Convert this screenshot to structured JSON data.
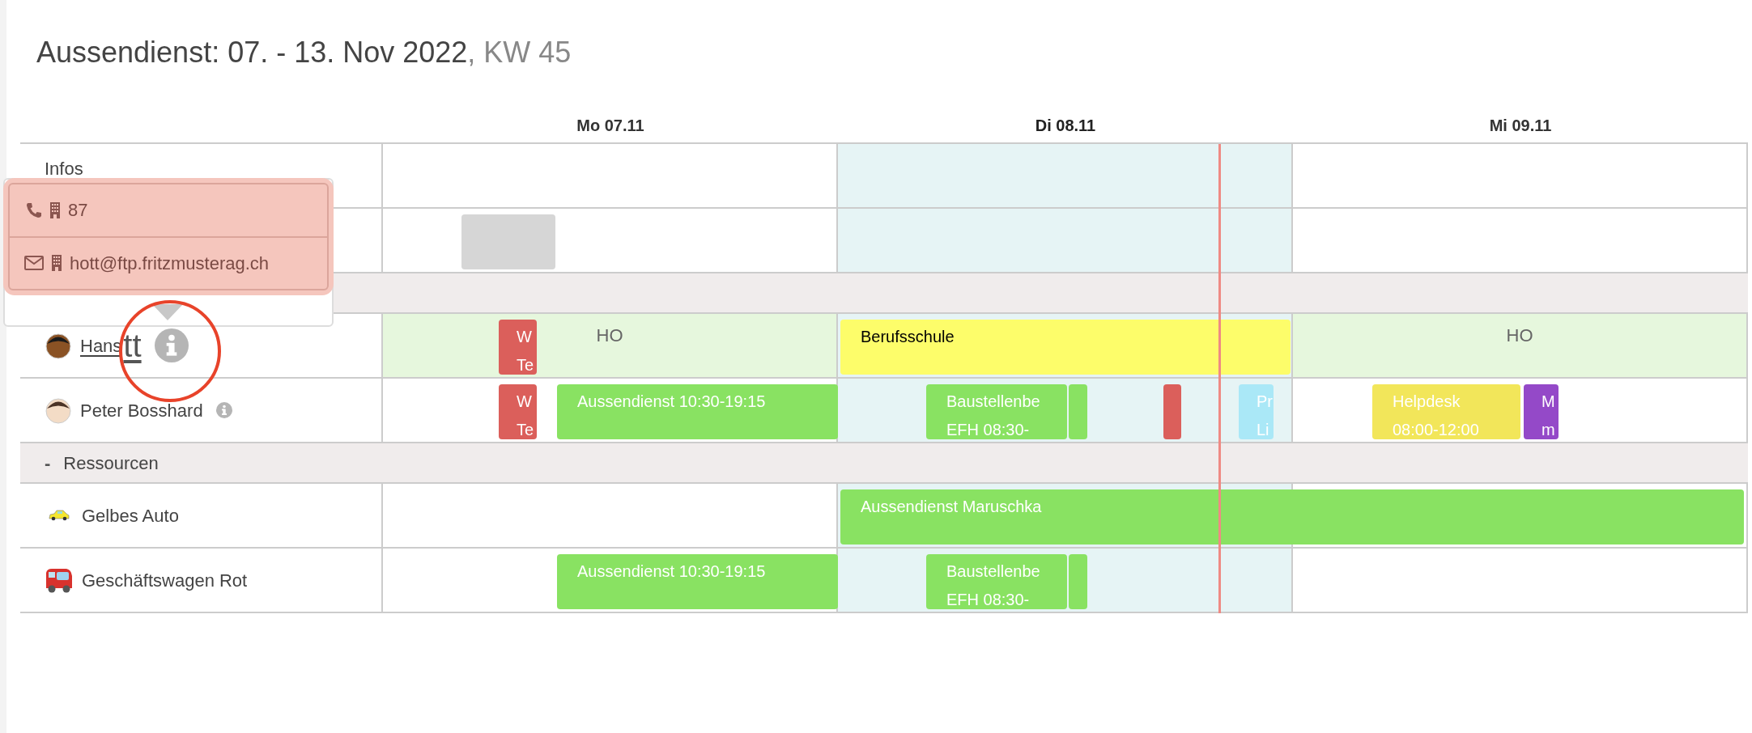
{
  "title": {
    "main": "Aussendienst: 07. - 13. Nov 2022",
    "week": ", KW 45"
  },
  "columns": [
    {
      "label": "Mo 07.11",
      "today": false
    },
    {
      "label": "Di 08.11",
      "today": true
    },
    {
      "label": "Mi 09.11",
      "today": false
    }
  ],
  "rows": [
    {
      "kind": "info",
      "label": "Infos",
      "events": []
    },
    {
      "kind": "info",
      "events": [
        {
          "color": "#d6d6d6"
        }
      ]
    },
    {
      "kind": "group"
    },
    {
      "kind": "person",
      "name": "Hans",
      "link": true,
      "overlay_text": "tt",
      "info": true,
      "home_office": [
        {
          "label": "HO"
        },
        {
          "label": "HO"
        }
      ],
      "events": [
        {
          "color": "#db5f5b",
          "dark_text": false,
          "lines": [
            "W",
            "Te"
          ]
        },
        {
          "color": "#fdfd6a",
          "dark_text": true,
          "lines": [
            "Berufsschule"
          ]
        }
      ]
    },
    {
      "kind": "person",
      "name": "Peter Bosshard",
      "link": false,
      "info": true,
      "events": [
        {
          "color": "#db5f5b",
          "dark_text": false,
          "lines": [
            "W",
            "Te"
          ]
        },
        {
          "color": "#89e262",
          "dark_text": false,
          "lines": [
            "Aussendienst 10:30-19:15"
          ]
        },
        {
          "color": "#89e262",
          "dark_text": false,
          "lines": [
            "Baustellenbe",
            "EFH 08:30-"
          ]
        },
        {
          "color": "#89e262"
        },
        {
          "color": "#db5f5b"
        },
        {
          "color": "#aae8f7",
          "dark_text": false,
          "lines": [
            "Pr",
            "Li"
          ]
        },
        {
          "color": "#f2e65a",
          "dark_text": false,
          "lines": [
            "Helpdesk",
            "08:00-12:00"
          ]
        },
        {
          "color": "#9449c8",
          "dark_text": false,
          "lines": [
            "M",
            "m"
          ]
        }
      ]
    },
    {
      "kind": "group",
      "toggle": "-",
      "label": "Ressourcen"
    },
    {
      "kind": "resource",
      "name": "Gelbes Auto",
      "events": [
        {
          "color": "#89e262",
          "dark_text": false,
          "lines": [
            "Aussendienst Maruschka"
          ]
        }
      ]
    },
    {
      "kind": "resource",
      "name": "Geschäftswagen Rot",
      "events": [
        {
          "color": "#89e262",
          "dark_text": false,
          "lines": [
            "Aussendienst 10:30-19:15"
          ]
        },
        {
          "color": "#89e262",
          "dark_text": false,
          "lines": [
            "Baustellenbe",
            "EFH 08:30-"
          ]
        },
        {
          "color": "#89e262"
        }
      ]
    }
  ],
  "popover": {
    "phone": "87",
    "email": "hott@ftp.fritzmusterag.ch"
  }
}
